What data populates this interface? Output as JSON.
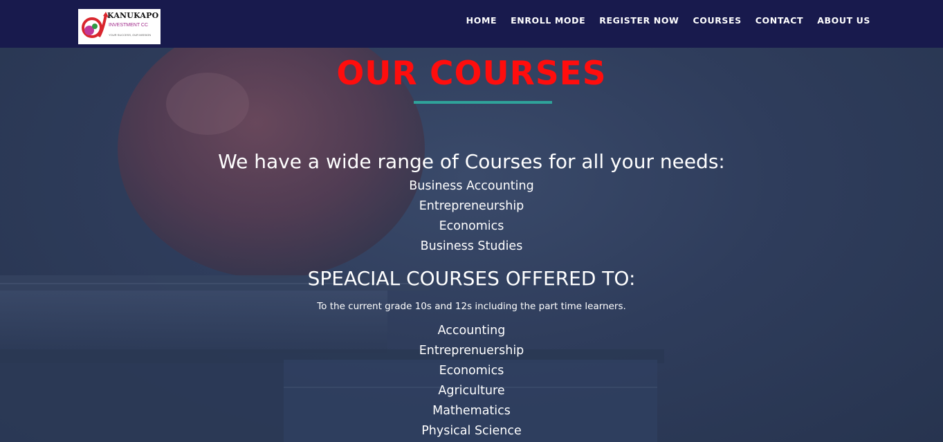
{
  "logo": {
    "brand": "KANUKAPO",
    "sub": "INVESTMENT CC",
    "tagline": "YOUR SUCCESS, OUR MISSION"
  },
  "nav": {
    "items": [
      {
        "label": "HOME"
      },
      {
        "label": "ENROLL MODE"
      },
      {
        "label": "REGISTER NOW"
      },
      {
        "label": "COURSES"
      },
      {
        "label": "CONTACT"
      },
      {
        "label": "ABOUT US"
      }
    ]
  },
  "page": {
    "title": "OUR COURSES",
    "intro_heading": "We have a wide range of Courses for all your needs:",
    "courses": [
      "Business Accounting",
      "Entrepreneurship",
      "Economics",
      "Business Studies"
    ],
    "special_heading": "SPEACIAL COURSES OFFERED TO:",
    "special_note": "To the current grade 10s and 12s including the part time learners.",
    "special_courses": [
      "Accounting",
      "Entreprenuership",
      "Economics",
      "Agriculture",
      "Mathematics",
      "Physical Science"
    ]
  },
  "colors": {
    "navbar_bg": "#181a4d",
    "title_red": "#ff0d0d",
    "underline_teal": "#2fa39a",
    "overlay_blue": "#2e3b5a"
  }
}
